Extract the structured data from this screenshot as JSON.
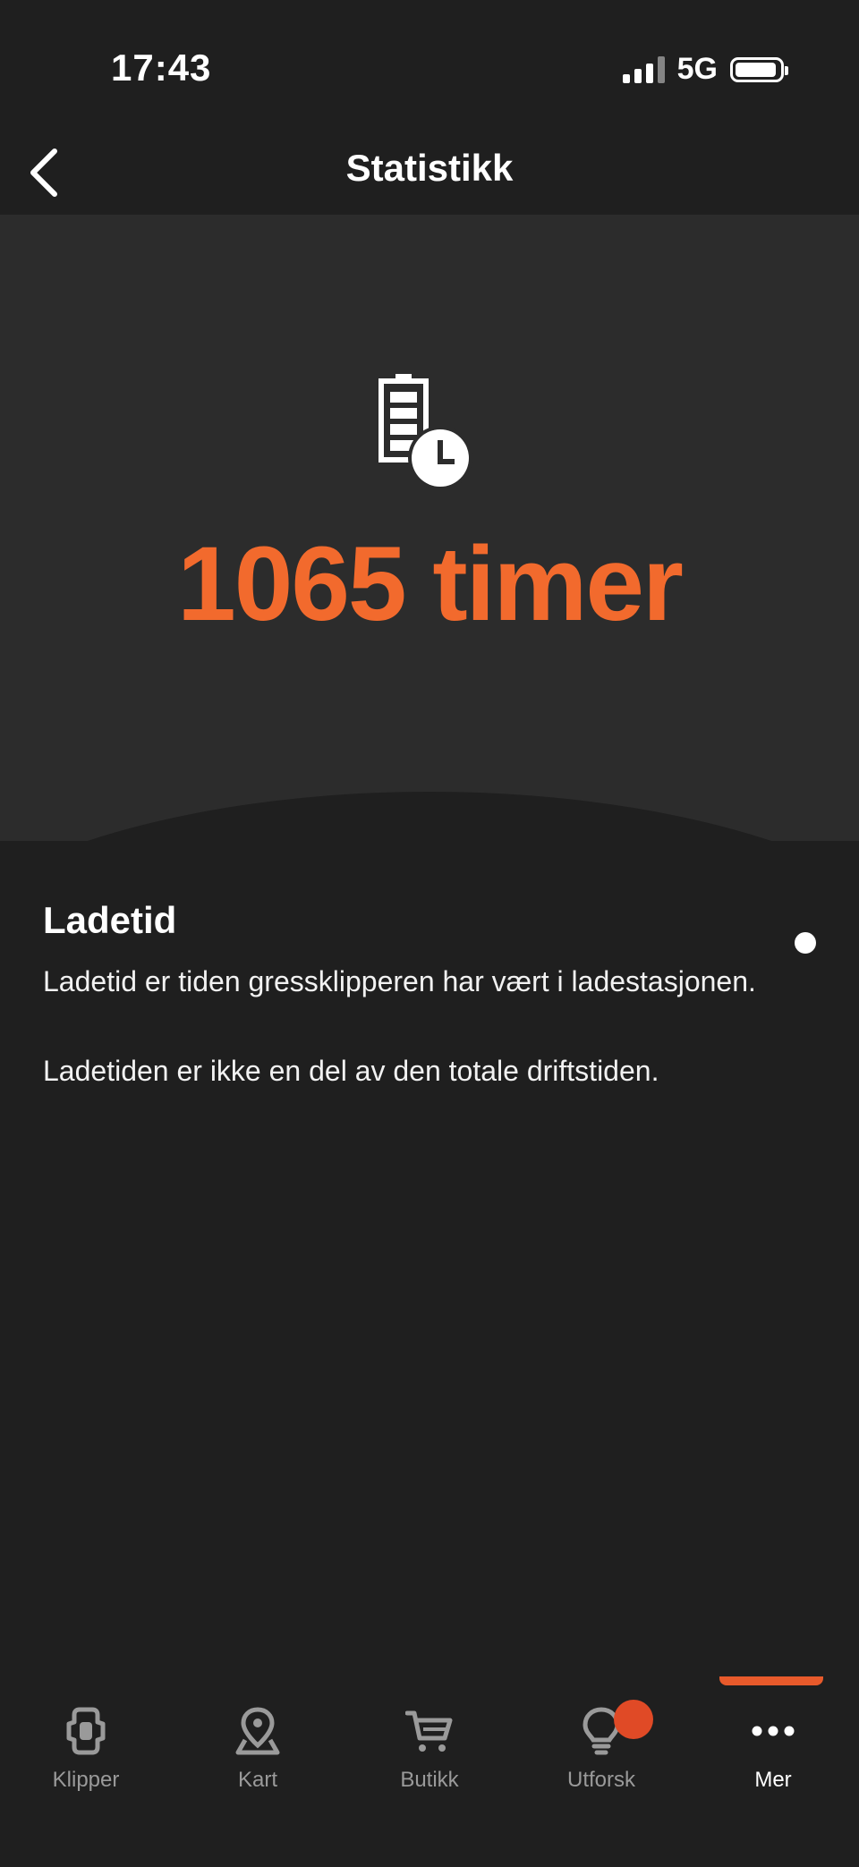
{
  "status_bar": {
    "time": "17:43",
    "network": "5G"
  },
  "header": {
    "title": "Statistikk",
    "back_icon": "chevron-left-icon"
  },
  "hero": {
    "icon": "battery-clock-icon",
    "value": "1065 timer"
  },
  "info": {
    "title": "Ladetid",
    "paragraphs": [
      "Ladetid er tiden gressklipperen har vært i ladestasjonen.",
      "Ladetiden er ikke en del av den totale driftstiden."
    ]
  },
  "tabs": [
    {
      "label": "Klipper",
      "icon": "mower-icon"
    },
    {
      "label": "Kart",
      "icon": "map-pin-icon"
    },
    {
      "label": "Butikk",
      "icon": "cart-icon"
    },
    {
      "label": "Utforsk",
      "icon": "lightbulb-icon"
    },
    {
      "label": "Mer",
      "icon": "more-icon"
    }
  ],
  "colors": {
    "accent": "#f26a2d",
    "background": "#1f1f1f",
    "hero_background": "#2c2c2c",
    "badge": "#e04a26"
  }
}
